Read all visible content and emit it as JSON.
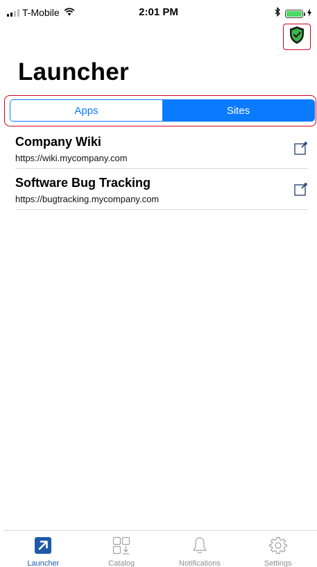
{
  "status_bar": {
    "carrier": "T-Mobile",
    "time": "2:01 PM"
  },
  "header": {
    "title": "Launcher"
  },
  "segmented": {
    "apps_label": "Apps",
    "sites_label": "Sites",
    "selected": "Sites"
  },
  "sites": [
    {
      "title": "Company Wiki",
      "url": "https://wiki.mycompany.com"
    },
    {
      "title": "Software Bug Tracking",
      "url": "https://bugtracking.mycompany.com"
    }
  ],
  "tab_bar": {
    "tabs": [
      {
        "label": "Launcher",
        "icon": "launcher-icon",
        "active": true
      },
      {
        "label": "Catalog",
        "icon": "catalog-icon",
        "active": false
      },
      {
        "label": "Notifications",
        "icon": "bell-icon",
        "active": false
      },
      {
        "label": "Settings",
        "icon": "gear-icon",
        "active": false
      }
    ]
  },
  "colors": {
    "accent": "#0a7aff",
    "highlight": "#d0021b",
    "shield_green": "#3cb44b",
    "tab_active": "#1e5aa8",
    "tab_inactive": "#8e8e93"
  }
}
